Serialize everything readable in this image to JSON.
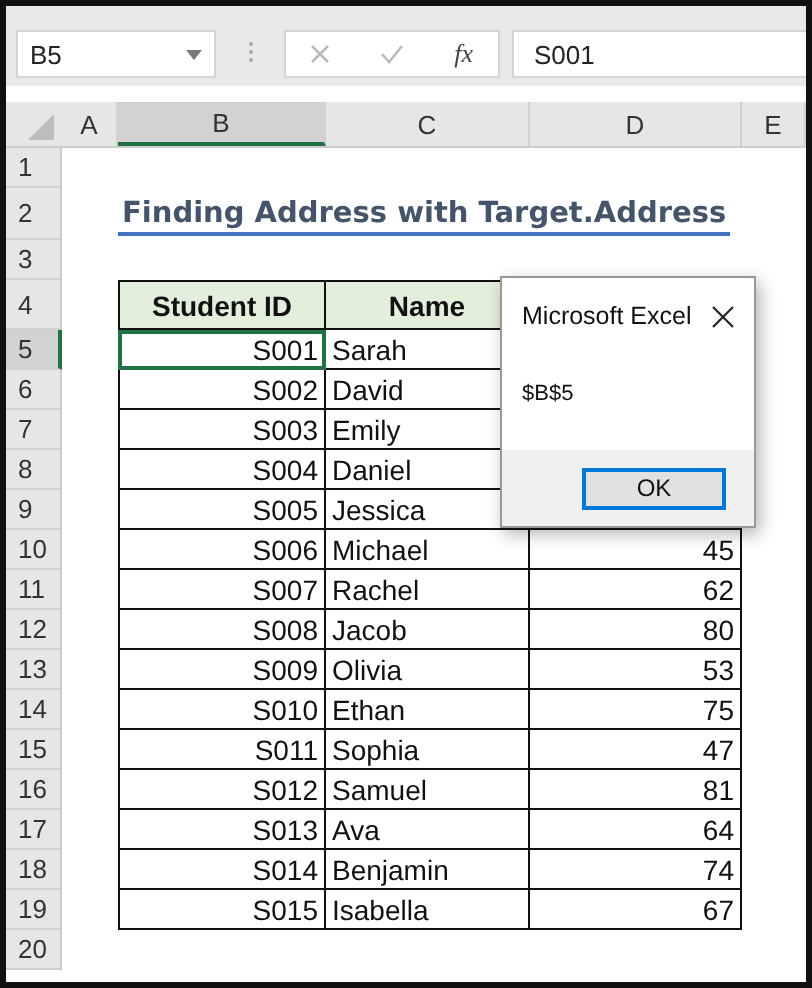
{
  "formula_bar": {
    "name_box": "B5",
    "function_label": "fx",
    "value": "S001"
  },
  "columns": [
    {
      "label": "A",
      "selected": false
    },
    {
      "label": "B",
      "selected": true
    },
    {
      "label": "C",
      "selected": false
    },
    {
      "label": "D",
      "selected": false
    },
    {
      "label": "E",
      "selected": false
    }
  ],
  "row_numbers": [
    {
      "label": "1",
      "selected": false
    },
    {
      "label": "2",
      "selected": false
    },
    {
      "label": "3",
      "selected": false
    },
    {
      "label": "4",
      "selected": false
    },
    {
      "label": "5",
      "selected": true
    },
    {
      "label": "6",
      "selected": false
    },
    {
      "label": "7",
      "selected": false
    },
    {
      "label": "8",
      "selected": false
    },
    {
      "label": "9",
      "selected": false
    },
    {
      "label": "10",
      "selected": false
    },
    {
      "label": "11",
      "selected": false
    },
    {
      "label": "12",
      "selected": false
    },
    {
      "label": "13",
      "selected": false
    },
    {
      "label": "14",
      "selected": false
    },
    {
      "label": "15",
      "selected": false
    },
    {
      "label": "16",
      "selected": false
    },
    {
      "label": "17",
      "selected": false
    },
    {
      "label": "18",
      "selected": false
    },
    {
      "label": "19",
      "selected": false
    },
    {
      "label": "20",
      "selected": false
    }
  ],
  "title": "Finding Address with Target.Address",
  "table": {
    "headers": [
      "Student ID",
      "Name"
    ],
    "rows": [
      {
        "id": "S001",
        "name": "Sarah",
        "selected": true
      },
      {
        "id": "S002",
        "name": "David",
        "selected": false
      },
      {
        "id": "S003",
        "name": "Emily",
        "selected": false
      },
      {
        "id": "S004",
        "name": "Daniel",
        "selected": false
      },
      {
        "id": "S005",
        "name": "Jessica",
        "selected": false
      },
      {
        "id": "S006",
        "name": "Michael",
        "score": "45",
        "selected": false
      },
      {
        "id": "S007",
        "name": "Rachel",
        "score": "62",
        "selected": false
      },
      {
        "id": "S008",
        "name": "Jacob",
        "score": "80",
        "selected": false
      },
      {
        "id": "S009",
        "name": "Olivia",
        "score": "53",
        "selected": false
      },
      {
        "id": "S010",
        "name": "Ethan",
        "score": "75",
        "selected": false
      },
      {
        "id": "S011",
        "name": "Sophia",
        "score": "47",
        "selected": false
      },
      {
        "id": "S012",
        "name": "Samuel",
        "score": "81",
        "selected": false
      },
      {
        "id": "S013",
        "name": "Ava",
        "score": "64",
        "selected": false
      },
      {
        "id": "S014",
        "name": "Benjamin",
        "score": "74",
        "selected": false
      },
      {
        "id": "S015",
        "name": "Isabella",
        "score": "67",
        "selected": false
      }
    ]
  },
  "dialog": {
    "title": "Microsoft Excel",
    "message": "$B$5",
    "button": "OK"
  }
}
